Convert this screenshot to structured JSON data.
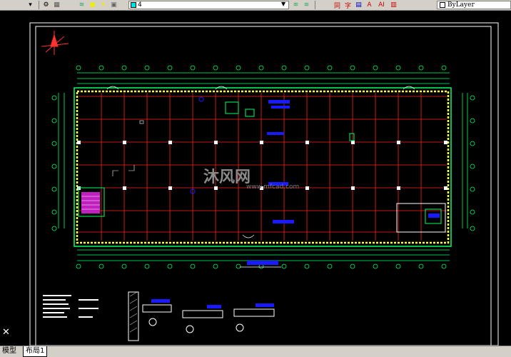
{
  "toolbar": {
    "layer_value": "4",
    "linetype_value": "ByLayer",
    "text_btn_1": "同",
    "text_btn_2": "字",
    "text_btn_3": "A",
    "text_btn_4": "AI"
  },
  "tabs": [
    {
      "label": "模型",
      "active": false
    },
    {
      "label": "布局1",
      "active": true
    }
  ],
  "watermark": {
    "text": "沐风网",
    "url": "www.mfcad.com"
  },
  "colors": {
    "background": "#000000",
    "grid": "#ff2020",
    "structure": "#00ff66",
    "walls": "#ffff40",
    "annotation": "#1a1aff",
    "frame": "#ffffff"
  }
}
